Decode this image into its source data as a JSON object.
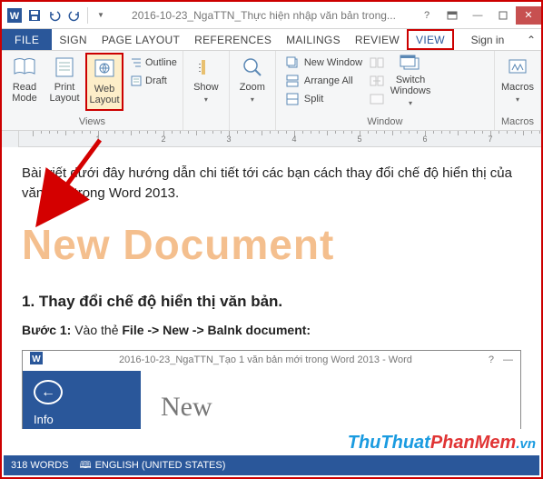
{
  "title": "2016-10-23_NgaTTN_Thực hiện nhập văn bản trong...",
  "tabs": {
    "file": "FILE",
    "items": [
      "SIGN",
      "PAGE LAYOUT",
      "REFERENCES",
      "MAILINGS",
      "REVIEW",
      "VIEW"
    ],
    "signin": "Sign in"
  },
  "ribbon": {
    "views": {
      "read": "Read Mode",
      "print": "Print Layout",
      "web": "Web Layout",
      "outline": "Outline",
      "draft": "Draft",
      "label": "Views"
    },
    "show": {
      "btn": "Show"
    },
    "zoom": {
      "btn": "Zoom"
    },
    "window": {
      "new": "New Window",
      "arrange": "Arrange All",
      "split": "Split",
      "switch": "Switch Windows",
      "label": "Window"
    },
    "macros": {
      "btn": "Macros",
      "label": "Macros"
    }
  },
  "ruler": {
    "labels": [
      "1",
      "2",
      "3",
      "4",
      "5",
      "6",
      "7"
    ]
  },
  "doc": {
    "intro": "Bài viết dưới đây hướng dẫn chi tiết tới các bạn cách thay đổi chế độ hiển thị của văn bản trong Word 2013.",
    "bigtitle": "New Document",
    "h2": "1. Thay đổi chế độ hiển thị văn bản.",
    "step_b": "Bước 1:",
    "step_rest": " Vào thẻ ",
    "step_path": "File -> New -> Balnk document:",
    "inner_title": "2016-10-23_NgaTTN_Tạo 1 văn bản mới trong Word 2013 - Word",
    "inner_info": "Info",
    "inner_new": "New"
  },
  "status": {
    "words": "318 WORDS",
    "lang_icon": "🕮",
    "lang": "ENGLISH (UNITED STATES)"
  },
  "watermark": {
    "a": "ThuThuat",
    "b": "PhanMem",
    "c": ".vn"
  }
}
